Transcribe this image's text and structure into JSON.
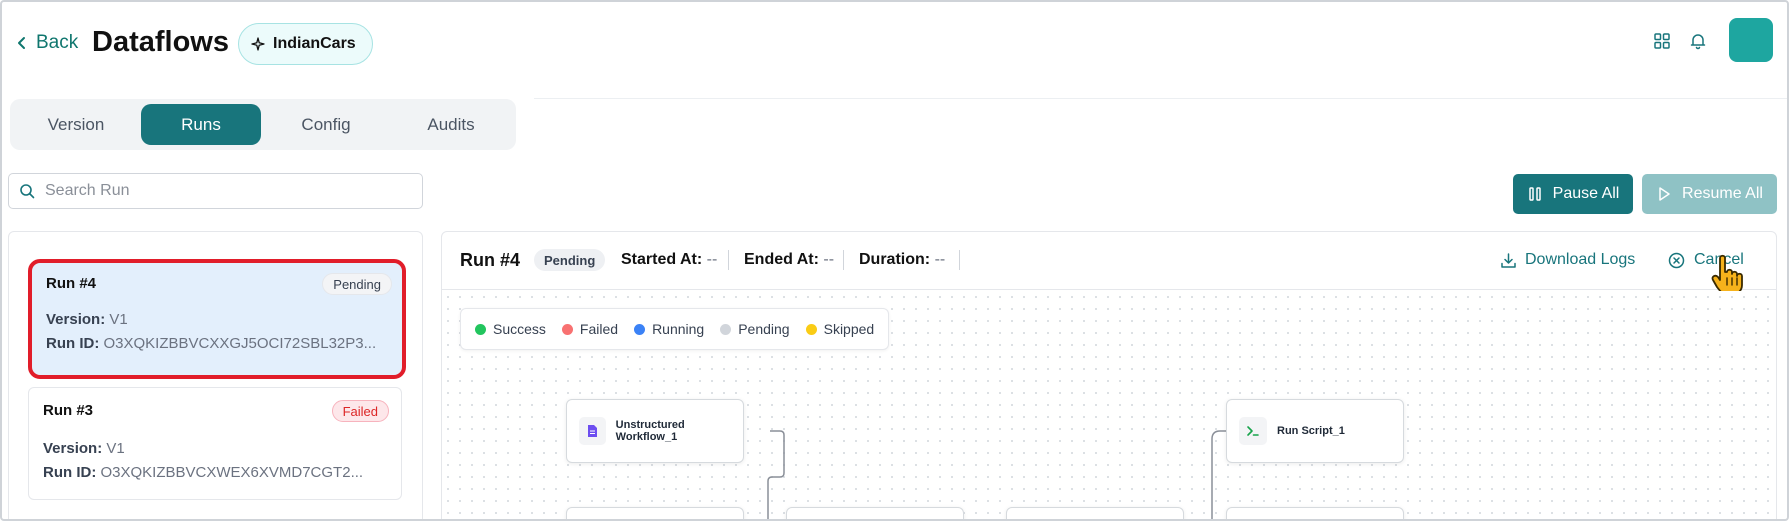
{
  "header": {
    "back_label": "Back",
    "title": "Dataflows",
    "project_name": "IndianCars"
  },
  "tabs": [
    {
      "label": "Version",
      "active": false
    },
    {
      "label": "Runs",
      "active": true
    },
    {
      "label": "Config",
      "active": false
    },
    {
      "label": "Audits",
      "active": false
    }
  ],
  "search": {
    "placeholder": "Search Run",
    "value": ""
  },
  "actions": {
    "pause_all": "Pause All",
    "resume_all": "Resume All"
  },
  "runs": [
    {
      "title": "Run #4",
      "status": "Pending",
      "version_label": "Version:",
      "version": "V1",
      "run_id_label": "Run ID:",
      "run_id": "O3XQKIZBBVCXXGJ5OCI72SBL32P3..."
    },
    {
      "title": "Run #3",
      "status": "Failed",
      "version_label": "Version:",
      "version": "V1",
      "run_id_label": "Run ID:",
      "run_id": "O3XQKIZBBVCXWEX6XVMD7CGT2..."
    }
  ],
  "detail": {
    "title": "Run #4",
    "status": "Pending",
    "started_label": "Started At:",
    "started_value": "--",
    "ended_label": "Ended At:",
    "ended_value": "--",
    "duration_label": "Duration:",
    "duration_value": "--",
    "download_logs": "Download Logs",
    "cancel": "Cancel"
  },
  "legend": [
    {
      "label": "Success",
      "color": "#22c55e"
    },
    {
      "label": "Failed",
      "color": "#f87171"
    },
    {
      "label": "Running",
      "color": "#3b82f6"
    },
    {
      "label": "Pending",
      "color": "#d1d5db"
    },
    {
      "label": "Skipped",
      "color": "#facc15"
    }
  ],
  "nodes": [
    {
      "label": "Unstructured Workflow_1",
      "icon": "document-icon"
    },
    {
      "label": "Run Script_1",
      "icon": "terminal-icon"
    }
  ],
  "colors": {
    "accent": "#18757c",
    "selection_border": "#e11d2a"
  }
}
